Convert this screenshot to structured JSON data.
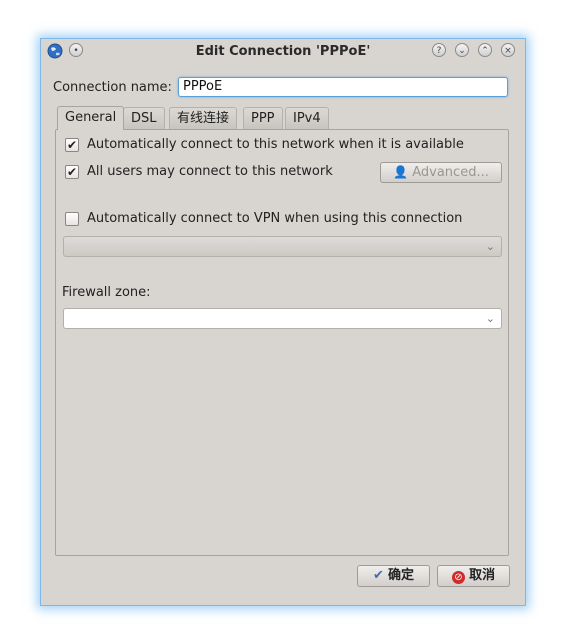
{
  "window": {
    "title": "Edit Connection 'PPPoE'",
    "title_buttons": [
      "help-icon",
      "minimize-icon",
      "maximize-icon",
      "close-icon"
    ]
  },
  "connection": {
    "name_label": "Connection name:",
    "name_value": "PPPoE"
  },
  "tabs": [
    {
      "label": "General",
      "active": true
    },
    {
      "label": "DSL"
    },
    {
      "label": "有线连接"
    },
    {
      "label": "PPP"
    },
    {
      "label": "IPv4"
    }
  ],
  "general": {
    "auto_connect": {
      "label": "Automatically connect to this network when it is available",
      "checked": true
    },
    "all_users": {
      "label": "All users may connect to this network",
      "checked": true
    },
    "advanced_button": "Advanced...",
    "vpn": {
      "label": "Automatically connect to VPN when using this connection",
      "checked": false
    },
    "vpn_select_value": "",
    "firewall_label": "Firewall zone:",
    "firewall_value": ""
  },
  "footer": {
    "ok_label": "确定",
    "cancel_label": "取消"
  },
  "colors": {
    "window_bg": "#d8d4d0",
    "focus_glow": "#5aa0d8"
  }
}
